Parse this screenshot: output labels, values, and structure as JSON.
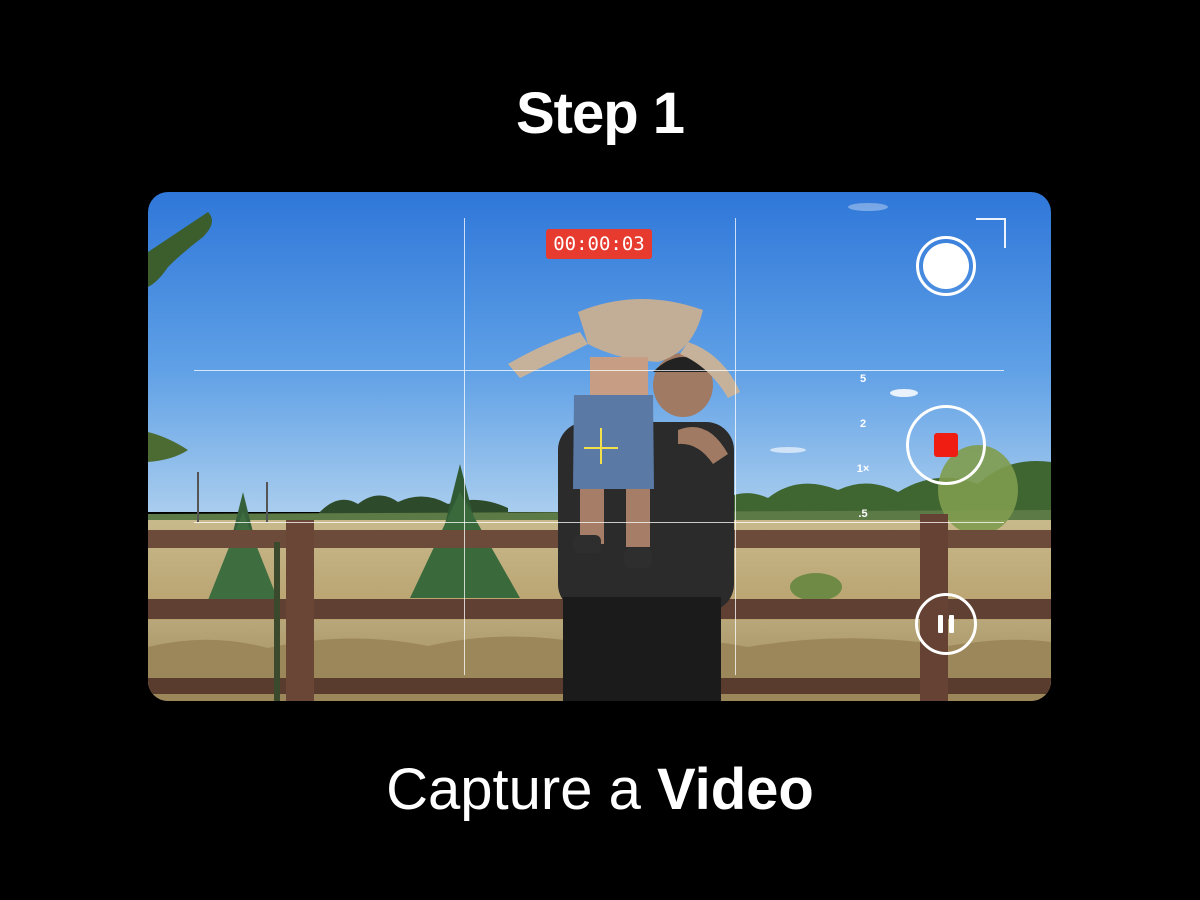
{
  "heading": {
    "title": "Step 1"
  },
  "caption": {
    "prefix": "Capture a",
    "emphasis": "Video"
  },
  "camera": {
    "timer": "00:00:03",
    "zoom_levels": [
      "5",
      "2",
      "1×",
      ".5"
    ],
    "grid": true,
    "recording": true
  },
  "colors": {
    "timer_bg": "#e63b2e",
    "record_stop": "#f01e12",
    "focus_reticle": "#f4e04a"
  },
  "icons": {
    "photo": "shutter-photo-icon",
    "record": "record-stop-icon",
    "pause": "pause-icon",
    "focus": "focus-crosshair-icon"
  }
}
